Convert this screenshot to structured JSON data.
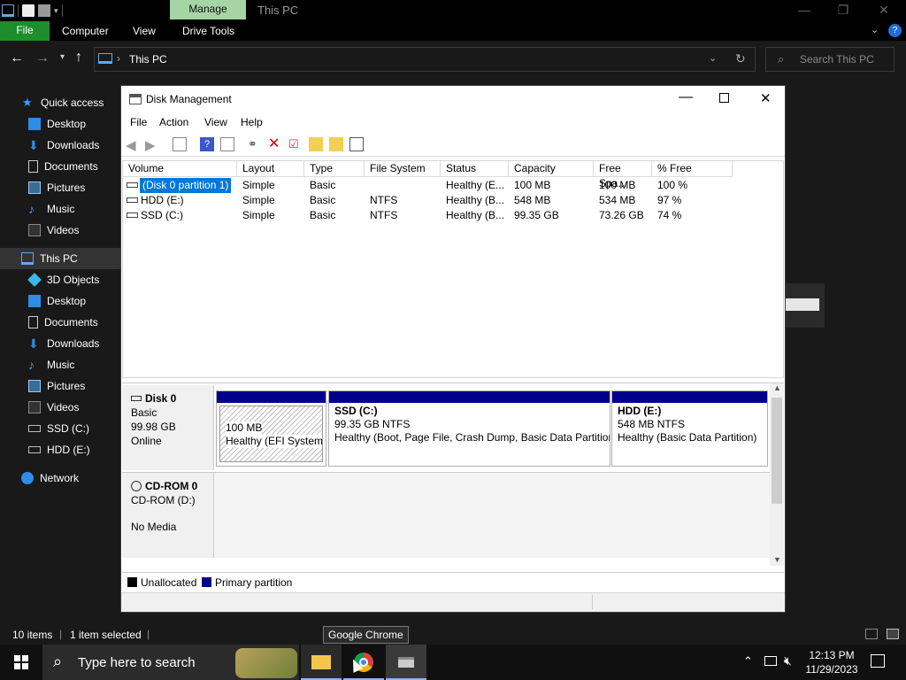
{
  "explorer": {
    "title": "This PC",
    "manage_tab": "Manage",
    "ribbon": {
      "file": "File",
      "tabs": [
        "Computer",
        "View",
        "Drive Tools"
      ]
    },
    "address": {
      "path": "This PC",
      "search_placeholder": "Search This PC"
    },
    "nav": {
      "quick_access": "Quick access",
      "quick_items": [
        "Desktop",
        "Downloads",
        "Documents",
        "Pictures",
        "Music",
        "Videos"
      ],
      "this_pc": "This PC",
      "pc_items": [
        "3D Objects",
        "Desktop",
        "Documents",
        "Downloads",
        "Music",
        "Pictures",
        "Videos",
        "SSD (C:)",
        "HDD (E:)"
      ],
      "network": "Network"
    },
    "status": {
      "items": "10 items",
      "selected": "1 item selected"
    }
  },
  "disk_mgmt": {
    "title": "Disk Management",
    "menu": [
      "File",
      "Action",
      "View",
      "Help"
    ],
    "columns": [
      "Volume",
      "Layout",
      "Type",
      "File System",
      "Status",
      "Capacity",
      "Free Spa...",
      "% Free"
    ],
    "rows": [
      {
        "volume": "(Disk 0 partition 1)",
        "layout": "Simple",
        "type": "Basic",
        "fs": "",
        "status": "Healthy (E...",
        "capacity": "100 MB",
        "free": "100 MB",
        "pct": "100 %"
      },
      {
        "volume": "HDD (E:)",
        "layout": "Simple",
        "type": "Basic",
        "fs": "NTFS",
        "status": "Healthy (B...",
        "capacity": "548 MB",
        "free": "534 MB",
        "pct": "97 %"
      },
      {
        "volume": "SSD (C:)",
        "layout": "Simple",
        "type": "Basic",
        "fs": "NTFS",
        "status": "Healthy (B...",
        "capacity": "99.35 GB",
        "free": "73.26 GB",
        "pct": "74 %"
      }
    ],
    "disk0": {
      "name": "Disk 0",
      "type": "Basic",
      "size": "99.98 GB",
      "state": "Online",
      "parts": [
        {
          "title": "",
          "size": "100 MB",
          "status": "Healthy (EFI System P"
        },
        {
          "title": "SSD  (C:)",
          "size": "99.35 GB NTFS",
          "status": "Healthy (Boot, Page File, Crash Dump, Basic Data Partition"
        },
        {
          "title": "HDD  (E:)",
          "size": "548 MB NTFS",
          "status": "Healthy (Basic Data Partition)"
        }
      ]
    },
    "cdrom": {
      "name": "CD-ROM 0",
      "drive": "CD-ROM (D:)",
      "media": "No Media"
    },
    "legend": [
      "Unallocated",
      "Primary partition"
    ]
  },
  "taskbar": {
    "search_placeholder": "Type here to search",
    "tooltip": "Google Chrome",
    "time": "12:13 PM",
    "date": "11/29/2023"
  },
  "colors": {
    "accent_green": "#1e8d2c",
    "manage_tab": "#a6d4a4",
    "primary_partition": "#00008b",
    "selection": "#0078d7"
  }
}
